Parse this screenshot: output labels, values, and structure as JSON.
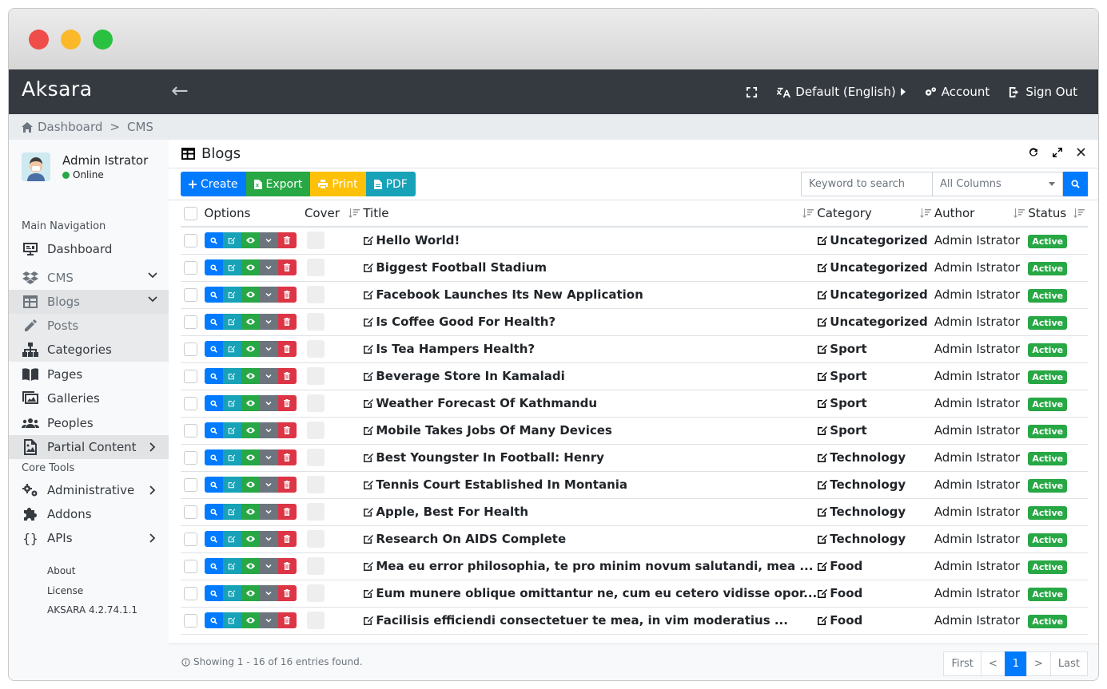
{
  "navbar": {
    "brand": "Aksara",
    "language": "Default (English)",
    "account": "Account",
    "sign_out": "Sign Out"
  },
  "breadcrumb": {
    "home": "Dashboard",
    "separator": ">",
    "current": "CMS"
  },
  "user": {
    "name": "Admin Istrator",
    "status": "Online"
  },
  "sidebar": {
    "main_header": "Main Navigation",
    "dashboard": "Dashboard",
    "cms": "CMS",
    "blogs": "Blogs",
    "posts": "Posts",
    "categories": "Categories",
    "pages": "Pages",
    "galleries": "Galleries",
    "peoples": "Peoples",
    "partial": "Partial Content",
    "core_header": "Core Tools",
    "administrative": "Administrative",
    "addons": "Addons",
    "apis": "APIs",
    "about": "About",
    "license": "License",
    "version": "AKSARA 4.2.74.1.1"
  },
  "card": {
    "title": "Blogs"
  },
  "toolbar": {
    "create": "Create",
    "export": "Export",
    "print": "Print",
    "pdf": "PDF",
    "search_placeholder": "Keyword to search",
    "column_select": "All Columns"
  },
  "table": {
    "headers": {
      "options": "Options",
      "cover": "Cover",
      "title": "Title",
      "category": "Category",
      "author": "Author",
      "status": "Status"
    },
    "rows": [
      {
        "title": "Hello World!",
        "category": "Uncategorized",
        "author": "Admin Istrator",
        "status": "Active"
      },
      {
        "title": "Biggest Football Stadium",
        "category": "Uncategorized",
        "author": "Admin Istrator",
        "status": "Active"
      },
      {
        "title": "Facebook Launches Its New Application",
        "category": "Uncategorized",
        "author": "Admin Istrator",
        "status": "Active"
      },
      {
        "title": "Is Coffee Good For Health?",
        "category": "Uncategorized",
        "author": "Admin Istrator",
        "status": "Active"
      },
      {
        "title": "Is Tea Hampers Health?",
        "category": "Sport",
        "author": "Admin Istrator",
        "status": "Active"
      },
      {
        "title": "Beverage Store In Kamaladi",
        "category": "Sport",
        "author": "Admin Istrator",
        "status": "Active"
      },
      {
        "title": "Weather Forecast Of Kathmandu",
        "category": "Sport",
        "author": "Admin Istrator",
        "status": "Active"
      },
      {
        "title": "Mobile Takes Jobs Of Many Devices",
        "category": "Sport",
        "author": "Admin Istrator",
        "status": "Active"
      },
      {
        "title": "Best Youngster In Football: Henry",
        "category": "Technology",
        "author": "Admin Istrator",
        "status": "Active"
      },
      {
        "title": "Tennis Court Established In Montania",
        "category": "Technology",
        "author": "Admin Istrator",
        "status": "Active"
      },
      {
        "title": "Apple, Best For Health",
        "category": "Technology",
        "author": "Admin Istrator",
        "status": "Active"
      },
      {
        "title": "Research On AIDS Complete",
        "category": "Technology",
        "author": "Admin Istrator",
        "status": "Active"
      },
      {
        "title": "Mea eu error philosophia, te pro minim novum salutandi, mea ...",
        "category": "Food",
        "author": "Admin Istrator",
        "status": "Active"
      },
      {
        "title": "Eum munere oblique omittantur ne, cum eu cetero vidisse opor...",
        "category": "Food",
        "author": "Admin Istrator",
        "status": "Active"
      },
      {
        "title": "Facilisis efficiendi consectetuer te mea, in vim moderatius ...",
        "category": "Food",
        "author": "Admin Istrator",
        "status": "Active"
      }
    ]
  },
  "footer": {
    "info": "Showing 1 - 16 of 16 entries found.",
    "first": "First",
    "prev": "<",
    "page": "1",
    "next": ">",
    "last": "Last"
  }
}
